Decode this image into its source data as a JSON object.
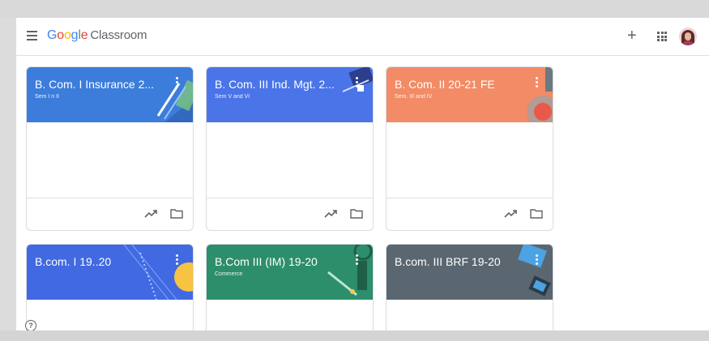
{
  "app": {
    "logo_google": "Google",
    "logo_product": "Classroom"
  },
  "colors": {
    "blue": "#3c78d8",
    "blue_dark": "#4169e1",
    "orange": "#f28b63",
    "teal": "#2e8b6e",
    "slate": "#5a6872"
  },
  "classes": [
    {
      "title": "B. Com. I Insurance 2...",
      "subtitle": "Sem I n II",
      "color": "#3c7ddb"
    },
    {
      "title": "B. Com. III Ind. Mgt. 2...",
      "subtitle": "Sem V and VI",
      "color": "#4a74e8"
    },
    {
      "title": "B. Com. II 20-21 FE",
      "subtitle": "Sem. III and IV",
      "color": "#f28b66"
    },
    {
      "title": "B.com. I 19..20",
      "subtitle": "",
      "color": "#4169e1"
    },
    {
      "title": "B.Com III (IM) 19-20",
      "subtitle": "Commerce",
      "color": "#2d8e6c"
    },
    {
      "title": "B.com. III BRF 19-20",
      "subtitle": "",
      "color": "#5a6770"
    }
  ],
  "icons": {
    "menu": "hamburger-menu-icon",
    "add": "plus-icon",
    "apps": "apps-grid-icon",
    "more": "more-vert-icon",
    "trend": "trending-up-icon",
    "folder": "folder-icon",
    "help": "help-icon"
  },
  "help": {
    "symbol": "?"
  },
  "topbar": {
    "add_symbol": "+"
  }
}
